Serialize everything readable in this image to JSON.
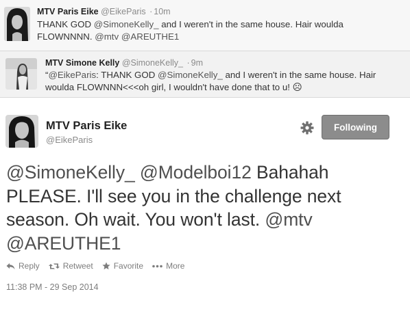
{
  "tweets": [
    {
      "name": "MTV Paris Eike",
      "handle": "@EikeParis",
      "time": "10m",
      "text_parts": [
        "THANK GOD ",
        "@SimoneKelly_",
        " and I weren't in the same house. Hair woulda FLOWNNNN. ",
        "@mtv",
        " ",
        "@AREUTHE1"
      ]
    },
    {
      "name": "MTV Simone Kelly",
      "handle": "@SimoneKelly_",
      "time": "9m",
      "text_parts": [
        "“",
        "@EikeParis",
        ": THANK GOD ",
        "@SimoneKelly_",
        " and I weren't in the same house. Hair woulda FLOWNNN<<<oh girl, I wouldn't have done that to u! ☹"
      ]
    }
  ],
  "main_tweet": {
    "name": "MTV Paris Eike",
    "handle": "@EikeParis",
    "follow_label": "Following",
    "text_parts": [
      "@SimoneKelly_",
      " ",
      "@Modelboi12",
      " Bahahah PLEASE. I'll see you in the challenge next season. Oh wait. You won't last. ",
      "@mtv",
      " ",
      "@AREUTHE1"
    ],
    "actions": {
      "reply": "Reply",
      "retweet": "Retweet",
      "favorite": "Favorite",
      "more": "More"
    },
    "timestamp": "11:38 PM - 29 Sep 2014"
  },
  "icons": [
    "gear-icon",
    "reply-icon",
    "retweet-icon",
    "star-icon",
    "more-icon"
  ]
}
